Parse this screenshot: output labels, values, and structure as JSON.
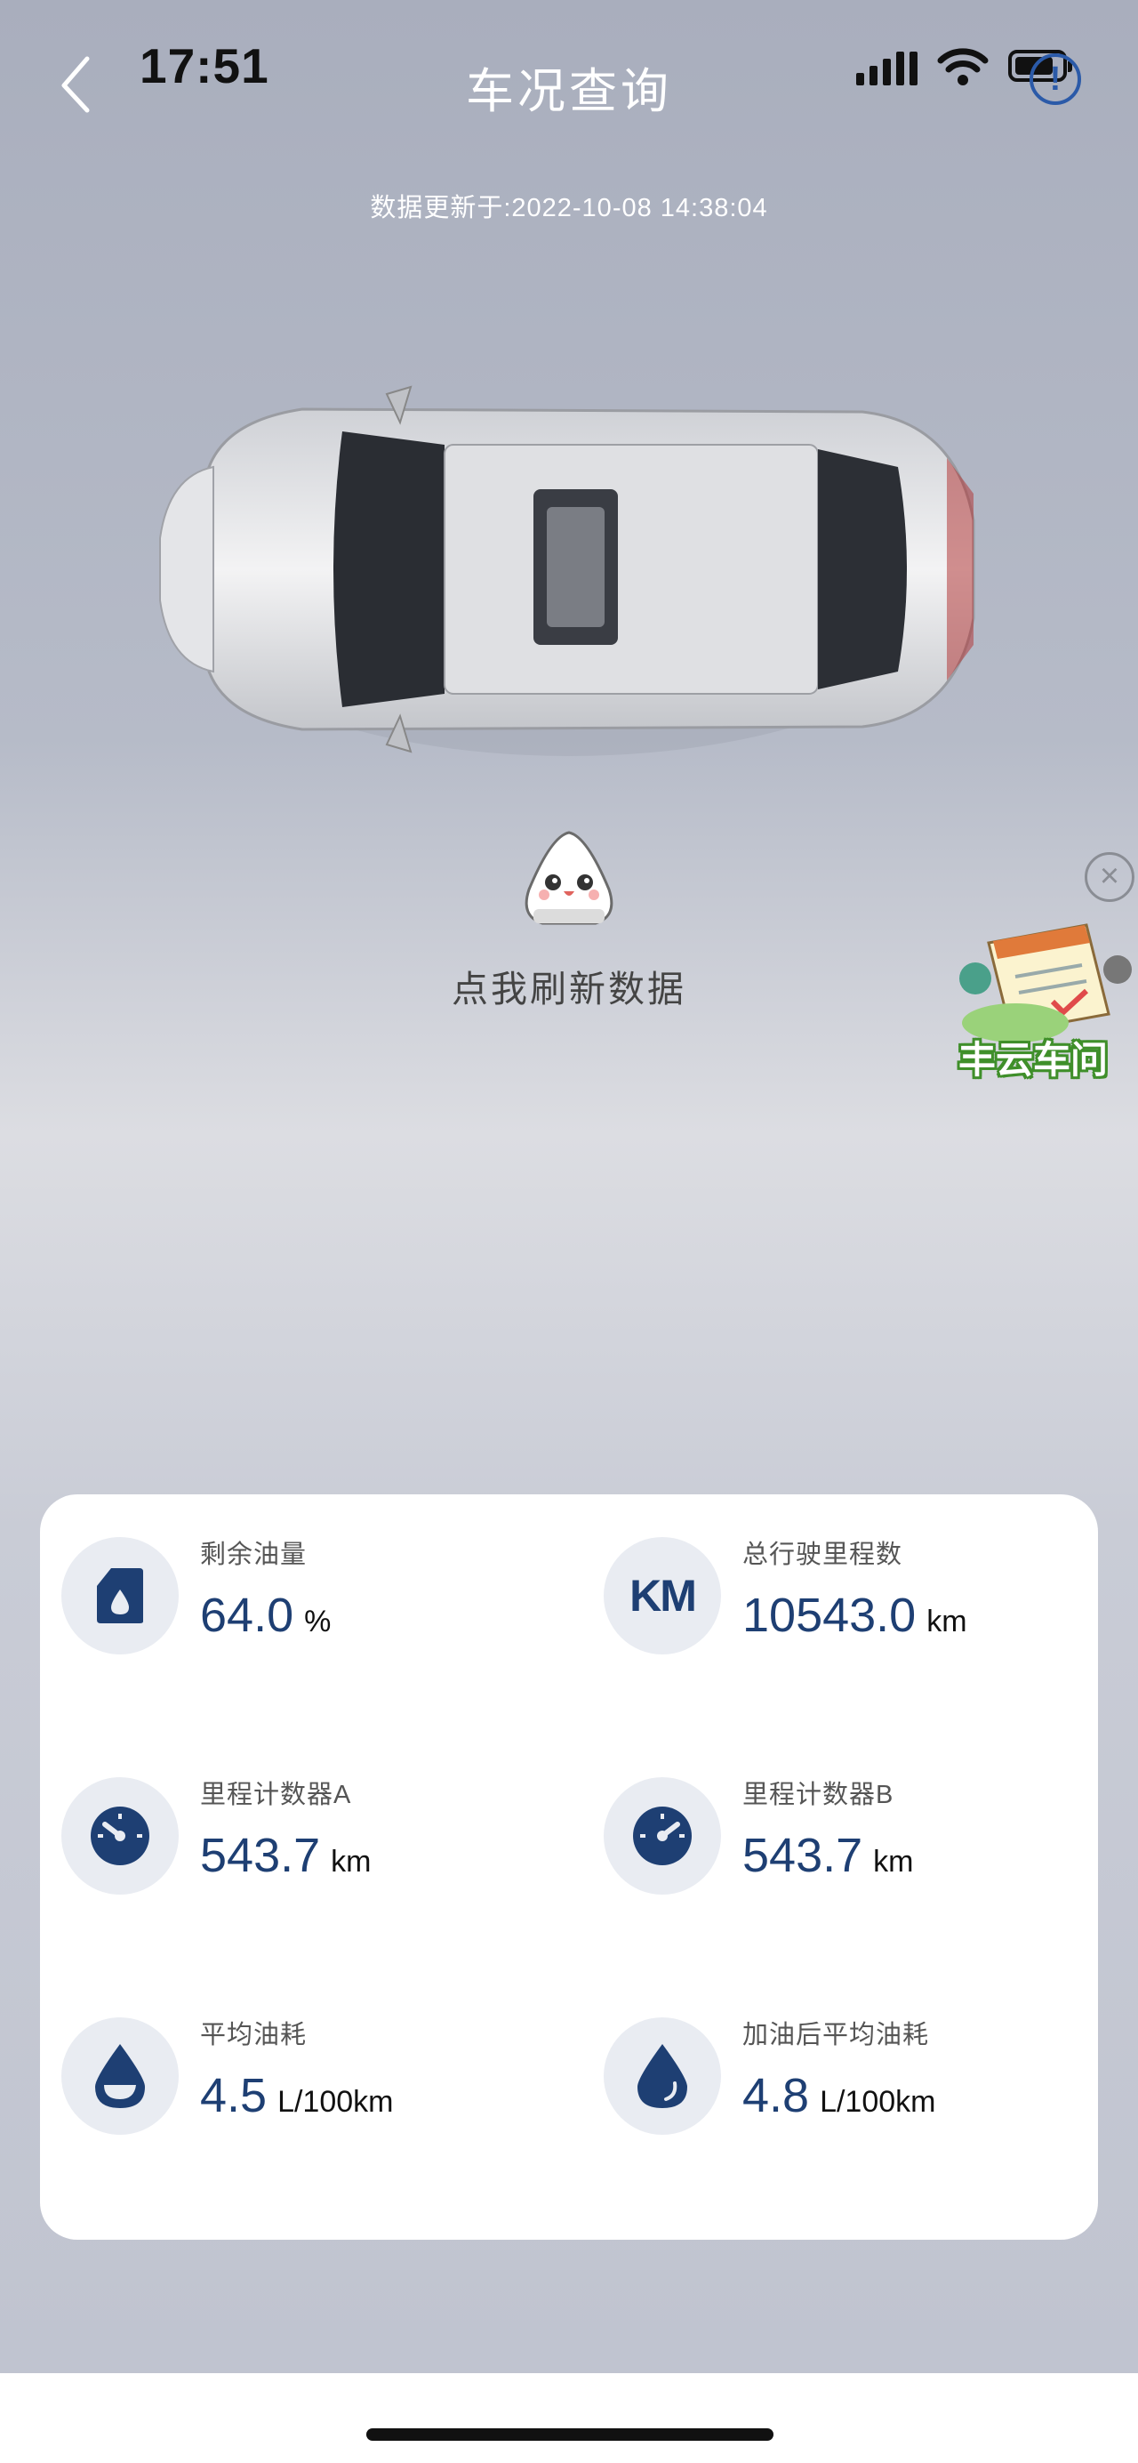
{
  "status_bar": {
    "time": "17:51"
  },
  "header": {
    "title": "车况查询",
    "alert_icon_text": "!"
  },
  "update_time": "数据更新于:2022-10-08 14:38:04",
  "refresh": {
    "label": "点我刷新数据"
  },
  "float_widget": {
    "label": "丰云车问",
    "close_text": "×"
  },
  "stats": [
    {
      "label": "剩余油量",
      "value": "64.0",
      "unit": "%",
      "icon": "fuel-tank-icon"
    },
    {
      "label": "总行驶里程数",
      "value": "10543.0",
      "unit": "km",
      "icon": "km-icon",
      "icon_text": "KM"
    },
    {
      "label": "里程计数器A",
      "value": "543.7",
      "unit": "km",
      "icon": "speedometer-icon"
    },
    {
      "label": "里程计数器B",
      "value": "543.7",
      "unit": "km",
      "icon": "speedometer-icon"
    },
    {
      "label": "平均油耗",
      "value": "4.5",
      "unit": "L/100km",
      "icon": "fuel-drop-icon"
    },
    {
      "label": "加油后平均油耗",
      "value": "4.8",
      "unit": "L/100km",
      "icon": "fuel-drop-icon"
    }
  ],
  "colors": {
    "accent": "#1e3f73",
    "title": "#ffffff",
    "alert": "#2b5aa8"
  }
}
